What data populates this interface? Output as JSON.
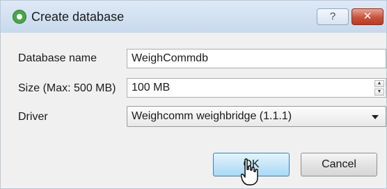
{
  "window": {
    "title": "Create database",
    "help_glyph": "?",
    "close_glyph": "✕",
    "app_icon": "green-circle-icon"
  },
  "form": {
    "name_label": "Database name",
    "name_value": "WeighCommdb",
    "size_label": "Size (Max: 500 MB)",
    "size_value": "100 MB",
    "driver_label": "Driver",
    "driver_value": "Weighcomm weighbridge (1.1.1)"
  },
  "buttons": {
    "ok": "OK",
    "cancel": "Cancel"
  },
  "colors": {
    "titlebar": "#d3e1f1",
    "close": "#c8523b",
    "ok_border": "#3c7fb1"
  }
}
